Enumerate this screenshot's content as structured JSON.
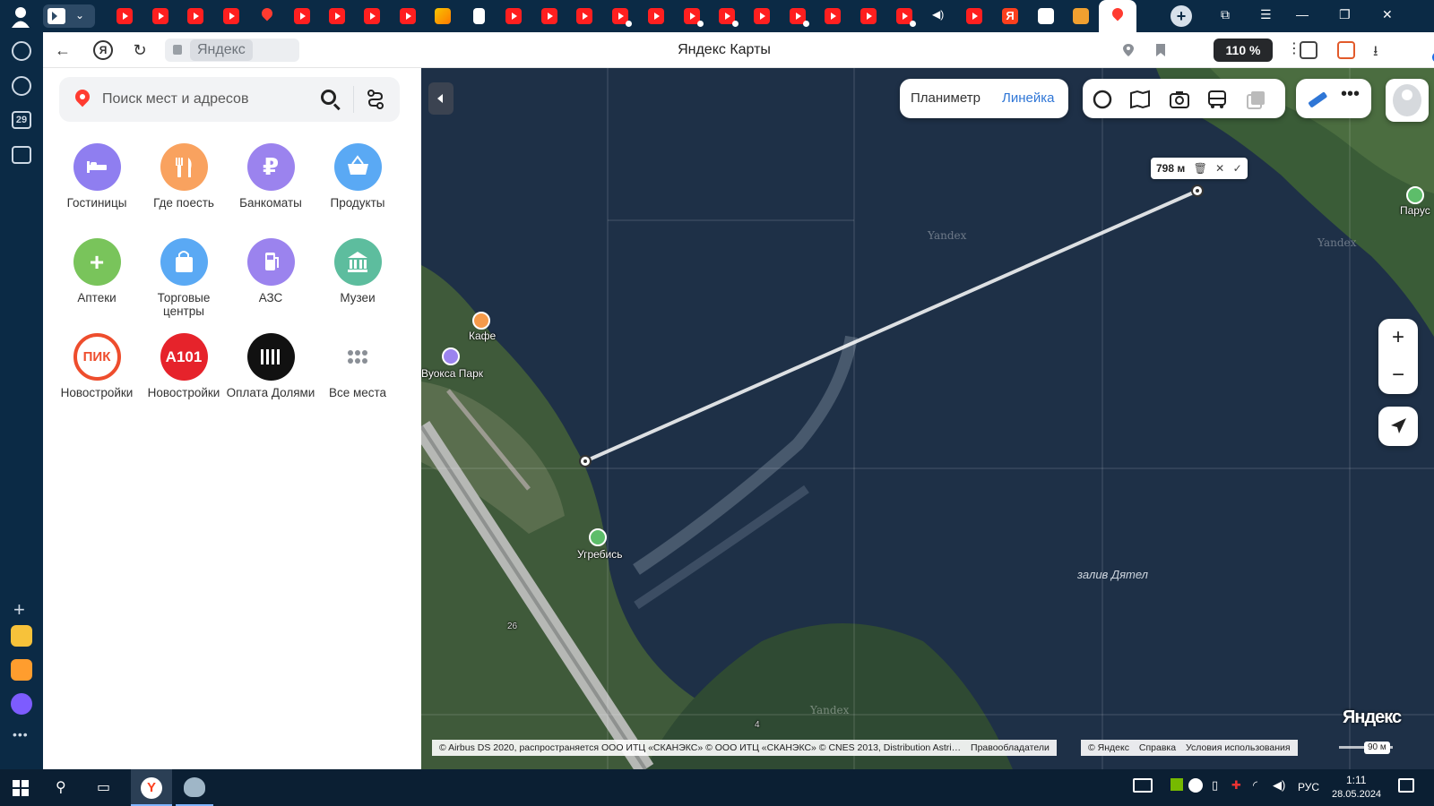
{
  "browser": {
    "page_title": "Яндекс Карты",
    "address_domain": "Яндекс",
    "zoom_level": "110 %",
    "ext_badge_count": "7",
    "sidebar_date": "29"
  },
  "search": {
    "placeholder": "Поиск мест и адресов"
  },
  "categories": [
    {
      "label": "Гостиницы",
      "icon": "bed-icon",
      "color": "#8f7ef0"
    },
    {
      "label": "Где поесть",
      "icon": "fork-knife-icon",
      "color": "#f9a25f"
    },
    {
      "label": "Банкоматы",
      "icon": "ruble-icon",
      "color": "#9b83ee"
    },
    {
      "label": "Продукты",
      "icon": "basket-icon",
      "color": "#5aa9f4"
    },
    {
      "label": "Аптеки",
      "icon": "cross-icon",
      "color": "#79c45b"
    },
    {
      "label": "Торговые центры",
      "icon": "shopping-bag-icon",
      "color": "#5aa9f4"
    },
    {
      "label": "АЗС",
      "icon": "fuel-icon",
      "color": "#9b83ee"
    },
    {
      "label": "Музеи",
      "icon": "museum-icon",
      "color": "#5dbd9e"
    },
    {
      "label": "Новостройки",
      "icon": "pik-logo",
      "logo_text": "ПИК",
      "color": "#ee4d2d"
    },
    {
      "label": "Новостройки",
      "icon": "a101-logo",
      "logo_text": "А101",
      "color": "#e6232b"
    },
    {
      "label": "Оплата Долями",
      "icon": "dolyami-logo",
      "color": "#111111"
    },
    {
      "label": "Все места",
      "icon": "dots-grid-icon",
      "color": "#ffffff"
    }
  ],
  "map": {
    "tools": {
      "planimeter": "Планиметр",
      "ruler": "Линейка"
    },
    "measurement": {
      "distance": "798 м"
    },
    "places": {
      "cafe": "Кафе",
      "park": "Вуокса Парк",
      "ugrebis": "Угребись",
      "parus": "Парус",
      "bay": "залив Дятел"
    },
    "watermarks": [
      "Yandex",
      "Yandex",
      "Yandex"
    ],
    "copyright": "© Airbus DS 2020, распространяется ООО ИТЦ «СКАНЭКС» © ООО ИТЦ «СКАНЭКС» © CNES 2013, Distribution Astri…",
    "rights_holders": "Правообладатели",
    "copyright_yandex": "© Яндекс",
    "help": "Справка",
    "terms": "Условия использования",
    "logo": "Яндекс",
    "scale": "90 м",
    "road_numbers": [
      "26",
      "4"
    ]
  },
  "taskbar": {
    "lang": "РУС",
    "time": "1:11",
    "date": "28.05.2024"
  },
  "colors": {
    "accent_blue": "#2f76d6",
    "water": "#1e3047",
    "forest": "#3f6a3e",
    "tab_bg": "#0b2a45"
  }
}
